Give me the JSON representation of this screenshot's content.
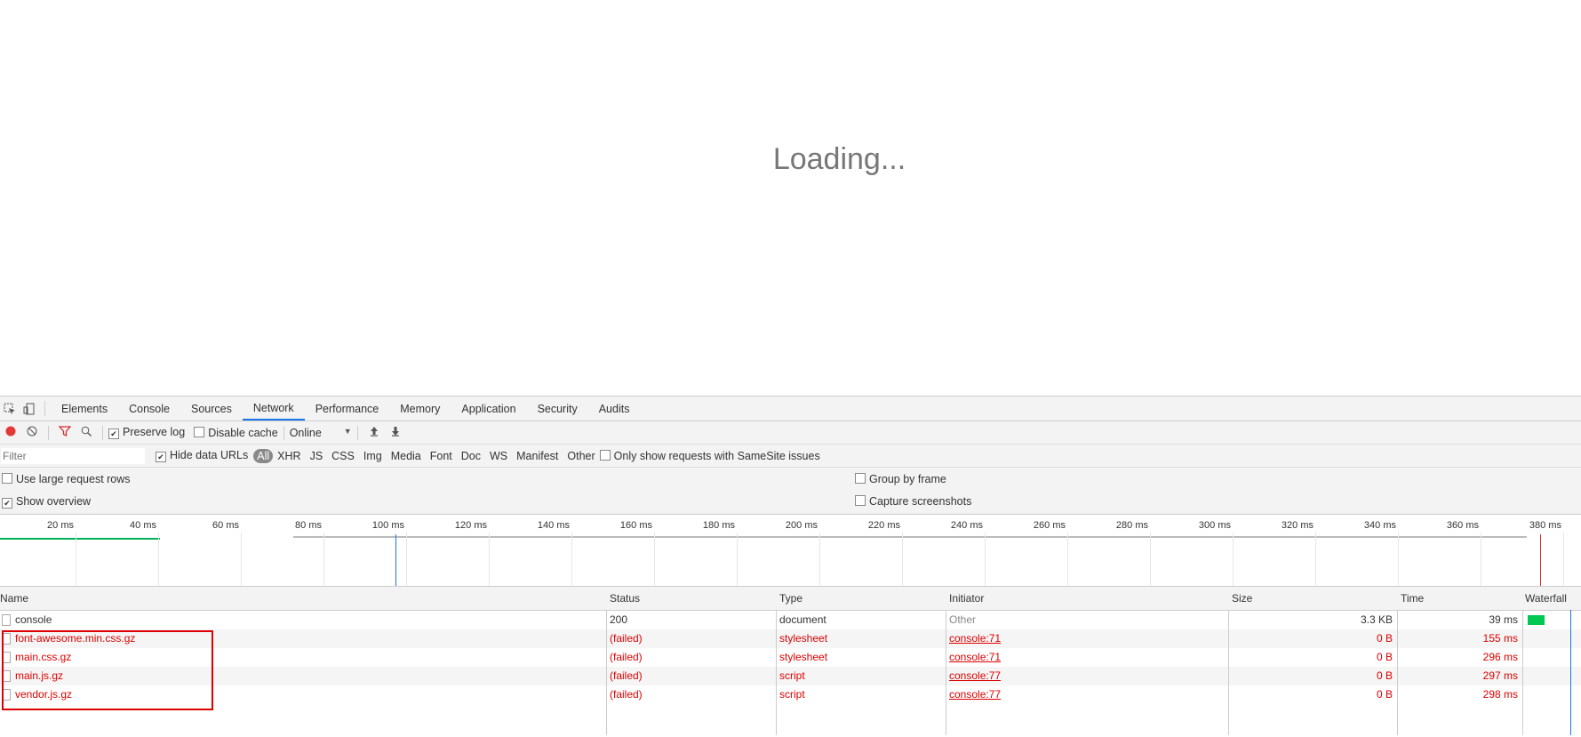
{
  "page": {
    "loading_text": "Loading..."
  },
  "devtools": {
    "tabs": [
      "Elements",
      "Console",
      "Sources",
      "Network",
      "Performance",
      "Memory",
      "Application",
      "Security",
      "Audits"
    ],
    "active_tab": "Network",
    "toolbar": {
      "preserve_log": "Preserve log",
      "disable_cache": "Disable cache",
      "throttle": "Online"
    },
    "filter": {
      "placeholder": "Filter",
      "hide_data_urls": "Hide data URLs",
      "types": [
        "All",
        "XHR",
        "JS",
        "CSS",
        "Img",
        "Media",
        "Font",
        "Doc",
        "WS",
        "Manifest",
        "Other"
      ],
      "samesite": "Only show requests with SameSite issues"
    },
    "settings": {
      "large_rows": "Use large request rows",
      "show_overview": "Show overview",
      "group_by_frame": "Group by frame",
      "capture_screenshots": "Capture screenshots"
    },
    "overview_ticks": [
      "20 ms",
      "40 ms",
      "60 ms",
      "80 ms",
      "100 ms",
      "120 ms",
      "140 ms",
      "160 ms",
      "180 ms",
      "200 ms",
      "220 ms",
      "240 ms",
      "260 ms",
      "280 ms",
      "300 ms",
      "320 ms",
      "340 ms",
      "360 ms",
      "380 ms"
    ],
    "columns": [
      "Name",
      "Status",
      "Type",
      "Initiator",
      "Size",
      "Time",
      "Waterfall"
    ],
    "requests": [
      {
        "name": "console",
        "status": "200",
        "type": "document",
        "initiator": "Other",
        "size": "3.3 KB",
        "time": "39 ms",
        "failed": false
      },
      {
        "name": "font-awesome.min.css.gz",
        "status": "(failed)",
        "type": "stylesheet",
        "initiator": "console:71",
        "size": "0 B",
        "time": "155 ms",
        "failed": true
      },
      {
        "name": "main.css.gz",
        "status": "(failed)",
        "type": "stylesheet",
        "initiator": "console:71",
        "size": "0 B",
        "time": "296 ms",
        "failed": true
      },
      {
        "name": "main.js.gz",
        "status": "(failed)",
        "type": "script",
        "initiator": "console:77",
        "size": "0 B",
        "time": "297 ms",
        "failed": true
      },
      {
        "name": "vendor.js.gz",
        "status": "(failed)",
        "type": "script",
        "initiator": "console:77",
        "size": "0 B",
        "time": "298 ms",
        "failed": true
      }
    ],
    "colors": {
      "accent": "#1a73e8",
      "error": "#dd0000",
      "waterfall_bar": "#00c853",
      "record": "#e53935"
    }
  }
}
